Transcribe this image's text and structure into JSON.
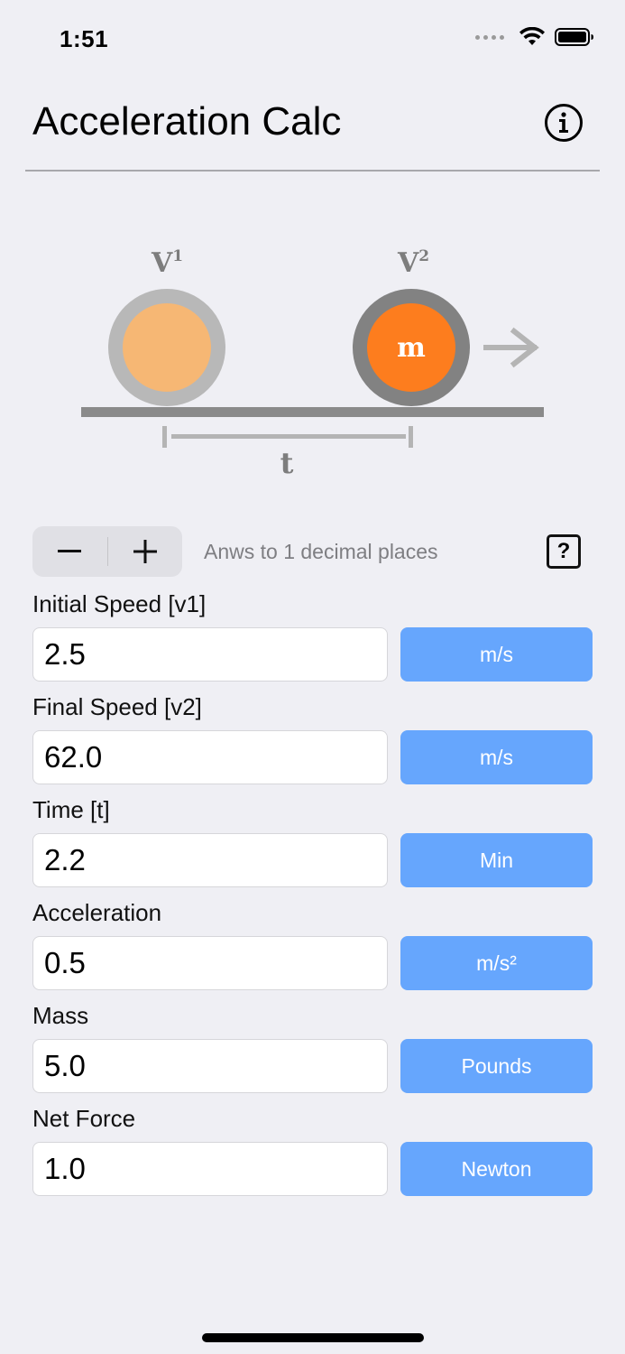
{
  "status_bar": {
    "time": "1:51"
  },
  "header": {
    "title": "Acceleration Calc",
    "info_icon": "info-icon"
  },
  "illustration": {
    "v1_label": "V",
    "v1_sup": "1",
    "v2_label": "V",
    "v2_sup": "2",
    "mass_label": "m",
    "time_label": "t",
    "colors": {
      "ball1": "#f6b774",
      "ball2": "#fd7d1e",
      "ring1": "#b8b8b8",
      "ring2": "#828282",
      "ground": "#8a8a8a",
      "arrow": "#b4b4b4"
    }
  },
  "controls": {
    "minus_icon": "minus-icon",
    "plus_icon": "plus-icon",
    "decimal_text": "Anws to 1 decimal places",
    "help_label": "?"
  },
  "fields": [
    {
      "label": "Initial Speed [v1]",
      "value": "2.5",
      "unit": "m/s"
    },
    {
      "label": "Final Speed [v2]",
      "value": "62.0",
      "unit": "m/s"
    },
    {
      "label": "Time [t]",
      "value": "2.2",
      "unit": "Min"
    },
    {
      "label": "Acceleration",
      "value": "0.5",
      "unit": "m/s²"
    },
    {
      "label": "Mass",
      "value": "5.0",
      "unit": "Pounds"
    },
    {
      "label": "Net Force",
      "value": "1.0",
      "unit": "Newton"
    }
  ],
  "accent_color": "#66a6fd"
}
